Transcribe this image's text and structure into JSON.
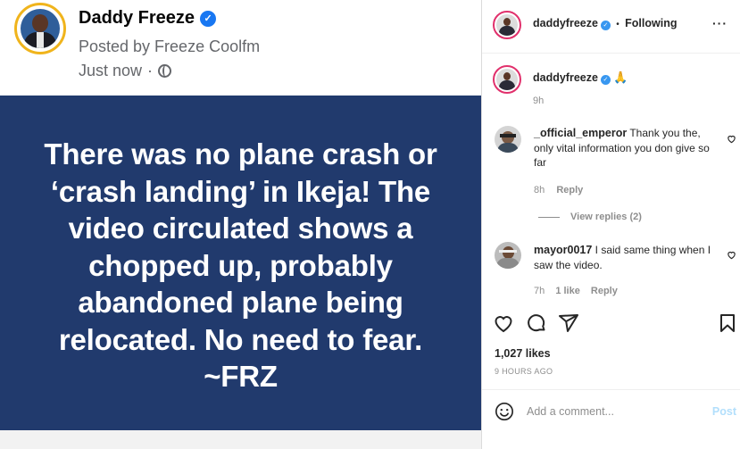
{
  "post": {
    "author_name": "Daddy Freeze",
    "posted_by": "Posted by Freeze Coolfm",
    "time": "Just now",
    "separator": "·",
    "message": "There was no plane crash or\n‘crash landing’ in Ikeja! The\nvideo circulated shows a\nchopped up, probably\nabandoned plane being\nrelocated. No need to fear.\n~FRZ",
    "card_color": "#213a6d"
  },
  "instagram": {
    "header": {
      "username": "daddyfreeze",
      "separator": "•",
      "follow_status": "Following",
      "more": "···"
    },
    "caption": {
      "username": "daddyfreeze",
      "emoji": "🙏",
      "time": "9h"
    },
    "comments": [
      {
        "username": "_official_emperor",
        "text": "Thank you the, only vital information you don give so far",
        "time": "8h",
        "reply": "Reply",
        "view_replies": "View replies (2)"
      },
      {
        "username": "mayor0017",
        "text": "I said same thing when I saw the video.",
        "time": "7h",
        "likes": "1 like",
        "reply": "Reply"
      }
    ],
    "likes": "1,027 likes",
    "time_ago": "9 HOURS AGO",
    "add_comment_placeholder": "Add a comment...",
    "post_button": "Post"
  }
}
